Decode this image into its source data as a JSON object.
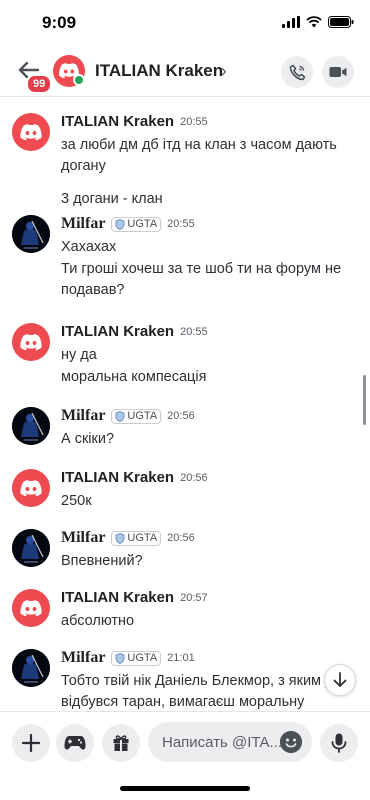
{
  "status_bar": {
    "time": "9:09"
  },
  "header": {
    "title": "ITALIAN Kraken",
    "chevron": "›",
    "unread_badge": "99"
  },
  "messages": [
    {
      "author": "ITALIAN Kraken",
      "time": "20:55",
      "lines": [
        "за люби дм дб ітд на клан з часом дають догану",
        "3 догани - клан"
      ]
    },
    {
      "author": "Milfar",
      "tag": "UGTA",
      "time": "20:55",
      "lines": [
        "Хахахах",
        "Ти гроші хочеш за те шоб ти на форум не подавав?"
      ]
    },
    {
      "author": "ITALIAN Kraken",
      "time": "20:55",
      "lines": [
        "ну да",
        "моральна компесація"
      ]
    },
    {
      "author": "Milfar",
      "tag": "UGTA",
      "time": "20:56",
      "lines": [
        "А скіки?"
      ]
    },
    {
      "author": "ITALIAN Kraken",
      "time": "20:56",
      "lines": [
        "250к"
      ]
    },
    {
      "author": "Milfar",
      "tag": "UGTA",
      "time": "20:56",
      "lines": [
        "Впевнений?"
      ]
    },
    {
      "author": "ITALIAN Kraken",
      "time": "20:57",
      "lines": [
        "абсолютно"
      ]
    },
    {
      "author": "Milfar",
      "tag": "UGTA",
      "time": "21:01",
      "lines": [
        "Тобто твій нік Даніель Блекмор, з яким у відбувся таран, вимагаєш моральну"
      ]
    }
  ],
  "composer": {
    "placeholder": "Написать @ITA..."
  },
  "colors": {
    "brand_red": "#ee4a4f",
    "online": "#23a55a",
    "badge": "#e23e49"
  }
}
